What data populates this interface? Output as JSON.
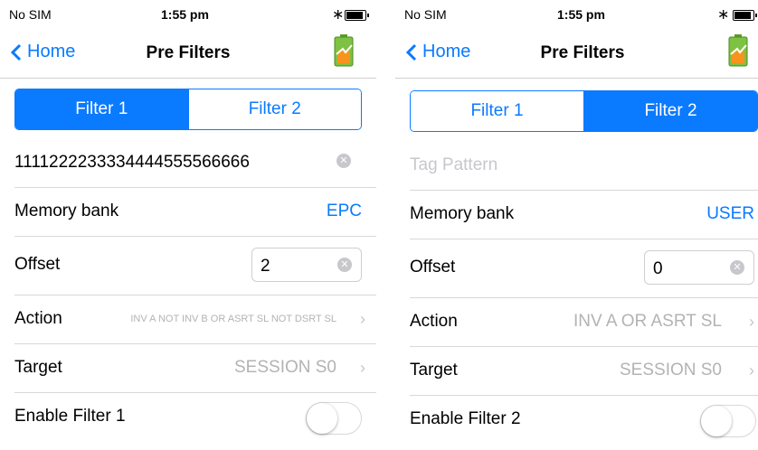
{
  "colors": {
    "accent": "#0a7aff",
    "separator": "#d8d8d8",
    "muted": "#b3b3b3"
  },
  "screens": [
    {
      "status": {
        "carrier": "No SIM",
        "time": "1:55 pm",
        "bluetooth": "∗"
      },
      "nav": {
        "back_label": "Home",
        "title": "Pre Filters"
      },
      "segments": [
        "Filter 1",
        "Filter 2"
      ],
      "active_segment": 0,
      "tag_pattern": {
        "value": "1111222233334444555566666",
        "placeholder": ""
      },
      "memory_bank": {
        "label": "Memory bank",
        "value": "EPC"
      },
      "offset": {
        "label": "Offset",
        "value": "2"
      },
      "action": {
        "label": "Action",
        "value": "INV A NOT INV B OR ASRT SL NOT DSRT SL"
      },
      "target": {
        "label": "Target",
        "value": "SESSION S0"
      },
      "enable": {
        "label": "Enable Filter 1",
        "on": false
      }
    },
    {
      "status": {
        "carrier": "No SIM",
        "time": "1:55 pm",
        "bluetooth": "∗"
      },
      "nav": {
        "back_label": "Home",
        "title": "Pre Filters"
      },
      "segments": [
        "Filter 1",
        "Filter 2"
      ],
      "active_segment": 1,
      "tag_pattern": {
        "value": "",
        "placeholder": "Tag Pattern"
      },
      "memory_bank": {
        "label": "Memory bank",
        "value": "USER"
      },
      "offset": {
        "label": "Offset",
        "value": "0"
      },
      "action": {
        "label": "Action",
        "value": "INV A OR ASRT SL"
      },
      "target": {
        "label": "Target",
        "value": "SESSION S0"
      },
      "enable": {
        "label": "Enable Filter 2",
        "on": false
      }
    }
  ]
}
